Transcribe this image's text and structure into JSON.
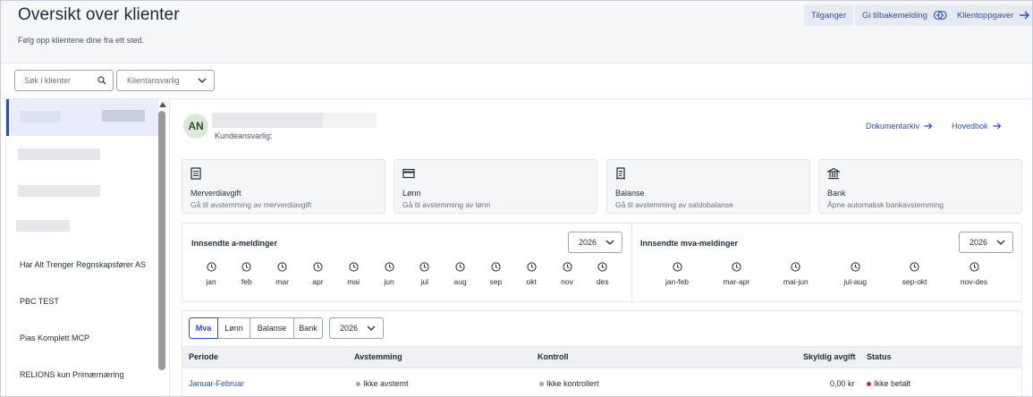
{
  "header": {
    "title": "Oversikt over klienter",
    "subtitle": "Følg opp klientene dine fra ett sted.",
    "buttons": {
      "access": "Tilganger",
      "feedback": "Gi tilbakemelding",
      "client_tasks": "Klientoppgaver"
    }
  },
  "toolbar": {
    "search_placeholder": "Søk i klienter",
    "responsible_placeholder": "Klientansvarlig"
  },
  "client_list": {
    "items": [
      "Har Alt Trenger Regnskapsfører AS",
      "PBC TEST",
      "Pias Komplett MCP",
      "RELIONS kun Primærnæring"
    ]
  },
  "client": {
    "initials": "AN",
    "responsible_label": "Kundeansvarlig:",
    "links": {
      "documents": "Dokumentarkiv",
      "ledger": "Hovedbok"
    }
  },
  "cards": [
    {
      "title": "Merverdiavgift",
      "subtitle": "Gå til avstemming av merverdiavgift",
      "icon": "document-list-icon"
    },
    {
      "title": "Lønn",
      "subtitle": "Gå til avstemming av lønn",
      "icon": "card-icon"
    },
    {
      "title": "Balanse",
      "subtitle": "Gå til avstemming av saldobalanse",
      "icon": "receipt-icon"
    },
    {
      "title": "Bank",
      "subtitle": "Åpne automatisk bankavstemming",
      "icon": "bank-icon"
    }
  ],
  "a_meldinger": {
    "title": "Innsendte a-meldinger",
    "year": "2026",
    "months": [
      "jan",
      "feb",
      "mar",
      "apr",
      "mai",
      "jun",
      "jul",
      "aug",
      "sep",
      "okt",
      "nov",
      "des"
    ]
  },
  "mva_meldinger": {
    "title": "Innsendte mva-meldinger",
    "year": "2026",
    "periods": [
      "jan-feb",
      "mar-apr",
      "mai-jun",
      "jul-aug",
      "sep-okt",
      "nov-des"
    ]
  },
  "tabs": {
    "items": [
      "Mva",
      "Lønn",
      "Balanse",
      "Bank"
    ],
    "active": "Mva",
    "year": "2026"
  },
  "table": {
    "headers": [
      "Periode",
      "Avstemming",
      "Kontroll",
      "Skyldig avgift",
      "Status"
    ],
    "rows": [
      {
        "period": "Januar-Februar",
        "reconciliation": "Ikke avstemt",
        "control": "Ikke kontrollert",
        "amount": "0,00 kr",
        "status": "Ikke betalt"
      }
    ]
  },
  "colors": {
    "accent": "#1e4ed8",
    "status_unpaid": "#dc2626",
    "status_neutral": "#9ca3af"
  }
}
